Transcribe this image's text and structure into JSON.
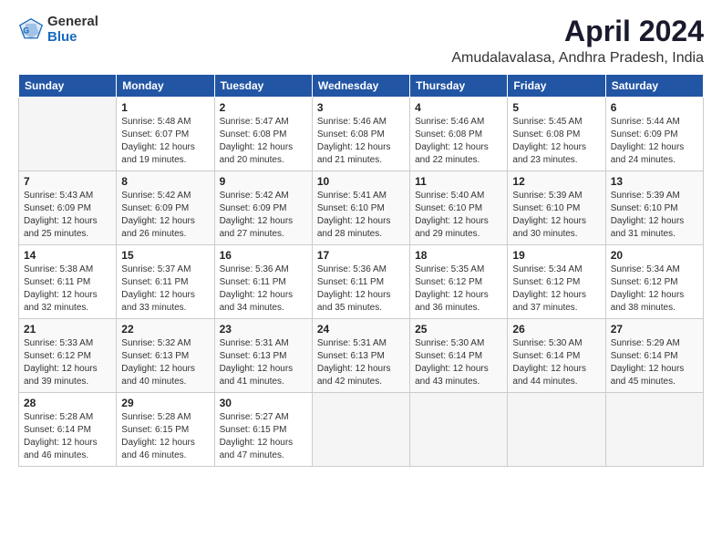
{
  "header": {
    "logo_general": "General",
    "logo_blue": "Blue",
    "title": "April 2024",
    "subtitle": "Amudalavalasa, Andhra Pradesh, India"
  },
  "days_of_week": [
    "Sunday",
    "Monday",
    "Tuesday",
    "Wednesday",
    "Thursday",
    "Friday",
    "Saturday"
  ],
  "weeks": [
    [
      {
        "day": "",
        "detail": ""
      },
      {
        "day": "1",
        "detail": "Sunrise: 5:48 AM\nSunset: 6:07 PM\nDaylight: 12 hours\nand 19 minutes."
      },
      {
        "day": "2",
        "detail": "Sunrise: 5:47 AM\nSunset: 6:08 PM\nDaylight: 12 hours\nand 20 minutes."
      },
      {
        "day": "3",
        "detail": "Sunrise: 5:46 AM\nSunset: 6:08 PM\nDaylight: 12 hours\nand 21 minutes."
      },
      {
        "day": "4",
        "detail": "Sunrise: 5:46 AM\nSunset: 6:08 PM\nDaylight: 12 hours\nand 22 minutes."
      },
      {
        "day": "5",
        "detail": "Sunrise: 5:45 AM\nSunset: 6:08 PM\nDaylight: 12 hours\nand 23 minutes."
      },
      {
        "day": "6",
        "detail": "Sunrise: 5:44 AM\nSunset: 6:09 PM\nDaylight: 12 hours\nand 24 minutes."
      }
    ],
    [
      {
        "day": "7",
        "detail": "Sunrise: 5:43 AM\nSunset: 6:09 PM\nDaylight: 12 hours\nand 25 minutes."
      },
      {
        "day": "8",
        "detail": "Sunrise: 5:42 AM\nSunset: 6:09 PM\nDaylight: 12 hours\nand 26 minutes."
      },
      {
        "day": "9",
        "detail": "Sunrise: 5:42 AM\nSunset: 6:09 PM\nDaylight: 12 hours\nand 27 minutes."
      },
      {
        "day": "10",
        "detail": "Sunrise: 5:41 AM\nSunset: 6:10 PM\nDaylight: 12 hours\nand 28 minutes."
      },
      {
        "day": "11",
        "detail": "Sunrise: 5:40 AM\nSunset: 6:10 PM\nDaylight: 12 hours\nand 29 minutes."
      },
      {
        "day": "12",
        "detail": "Sunrise: 5:39 AM\nSunset: 6:10 PM\nDaylight: 12 hours\nand 30 minutes."
      },
      {
        "day": "13",
        "detail": "Sunrise: 5:39 AM\nSunset: 6:10 PM\nDaylight: 12 hours\nand 31 minutes."
      }
    ],
    [
      {
        "day": "14",
        "detail": "Sunrise: 5:38 AM\nSunset: 6:11 PM\nDaylight: 12 hours\nand 32 minutes."
      },
      {
        "day": "15",
        "detail": "Sunrise: 5:37 AM\nSunset: 6:11 PM\nDaylight: 12 hours\nand 33 minutes."
      },
      {
        "day": "16",
        "detail": "Sunrise: 5:36 AM\nSunset: 6:11 PM\nDaylight: 12 hours\nand 34 minutes."
      },
      {
        "day": "17",
        "detail": "Sunrise: 5:36 AM\nSunset: 6:11 PM\nDaylight: 12 hours\nand 35 minutes."
      },
      {
        "day": "18",
        "detail": "Sunrise: 5:35 AM\nSunset: 6:12 PM\nDaylight: 12 hours\nand 36 minutes."
      },
      {
        "day": "19",
        "detail": "Sunrise: 5:34 AM\nSunset: 6:12 PM\nDaylight: 12 hours\nand 37 minutes."
      },
      {
        "day": "20",
        "detail": "Sunrise: 5:34 AM\nSunset: 6:12 PM\nDaylight: 12 hours\nand 38 minutes."
      }
    ],
    [
      {
        "day": "21",
        "detail": "Sunrise: 5:33 AM\nSunset: 6:12 PM\nDaylight: 12 hours\nand 39 minutes."
      },
      {
        "day": "22",
        "detail": "Sunrise: 5:32 AM\nSunset: 6:13 PM\nDaylight: 12 hours\nand 40 minutes."
      },
      {
        "day": "23",
        "detail": "Sunrise: 5:31 AM\nSunset: 6:13 PM\nDaylight: 12 hours\nand 41 minutes."
      },
      {
        "day": "24",
        "detail": "Sunrise: 5:31 AM\nSunset: 6:13 PM\nDaylight: 12 hours\nand 42 minutes."
      },
      {
        "day": "25",
        "detail": "Sunrise: 5:30 AM\nSunset: 6:14 PM\nDaylight: 12 hours\nand 43 minutes."
      },
      {
        "day": "26",
        "detail": "Sunrise: 5:30 AM\nSunset: 6:14 PM\nDaylight: 12 hours\nand 44 minutes."
      },
      {
        "day": "27",
        "detail": "Sunrise: 5:29 AM\nSunset: 6:14 PM\nDaylight: 12 hours\nand 45 minutes."
      }
    ],
    [
      {
        "day": "28",
        "detail": "Sunrise: 5:28 AM\nSunset: 6:14 PM\nDaylight: 12 hours\nand 46 minutes."
      },
      {
        "day": "29",
        "detail": "Sunrise: 5:28 AM\nSunset: 6:15 PM\nDaylight: 12 hours\nand 46 minutes."
      },
      {
        "day": "30",
        "detail": "Sunrise: 5:27 AM\nSunset: 6:15 PM\nDaylight: 12 hours\nand 47 minutes."
      },
      {
        "day": "",
        "detail": ""
      },
      {
        "day": "",
        "detail": ""
      },
      {
        "day": "",
        "detail": ""
      },
      {
        "day": "",
        "detail": ""
      }
    ]
  ]
}
